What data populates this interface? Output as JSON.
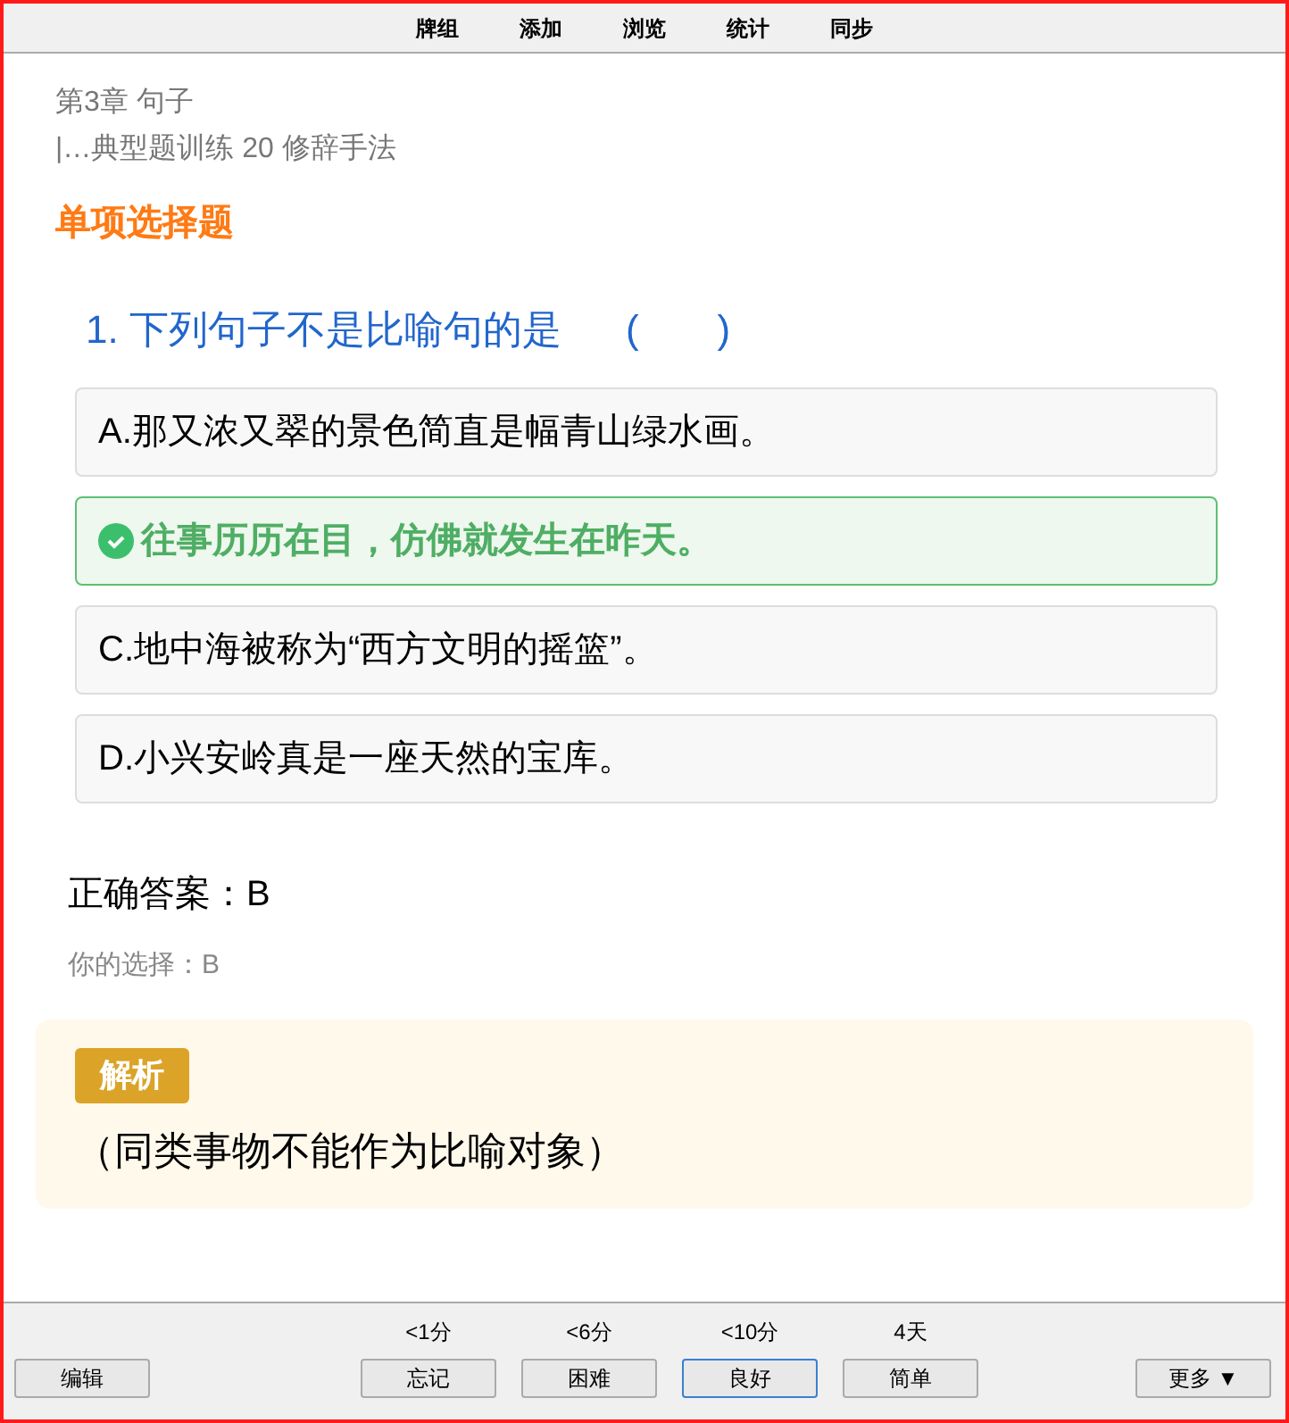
{
  "menu": [
    "牌组",
    "添加",
    "浏览",
    "统计",
    "同步"
  ],
  "breadcrumb": {
    "chapter": "第3章 句子",
    "section": "|…典型题训练 20 修辞手法"
  },
  "question_type": "单项选择题",
  "question": {
    "number": "1.",
    "text": "下列句子不是比喻句的是",
    "blank": "(　　)"
  },
  "options": [
    {
      "text": "A.那又浓又翠的景色简直是幅青山绿水画。",
      "selected": false
    },
    {
      "text": "往事历历在目，仿佛就发生在昨天。",
      "selected": true
    },
    {
      "text": "C.地中海被称为“西方文明的摇篮”。",
      "selected": false
    },
    {
      "text": "D.小兴安岭真是一座天然的宝库。",
      "selected": false
    }
  ],
  "correct_answer": "正确答案：B",
  "your_choice": "你的选择：B",
  "explanation": {
    "badge": "解析",
    "text": "（同类事物不能作为比喻对象）"
  },
  "bottom": {
    "edit": "编辑",
    "more": "更多 ▼",
    "answers": [
      {
        "time": "<1分",
        "label": "忘记",
        "selected": false
      },
      {
        "time": "<6分",
        "label": "困难",
        "selected": false
      },
      {
        "time": "<10分",
        "label": "良好",
        "selected": true
      },
      {
        "time": "4天",
        "label": "简单",
        "selected": false
      }
    ]
  }
}
